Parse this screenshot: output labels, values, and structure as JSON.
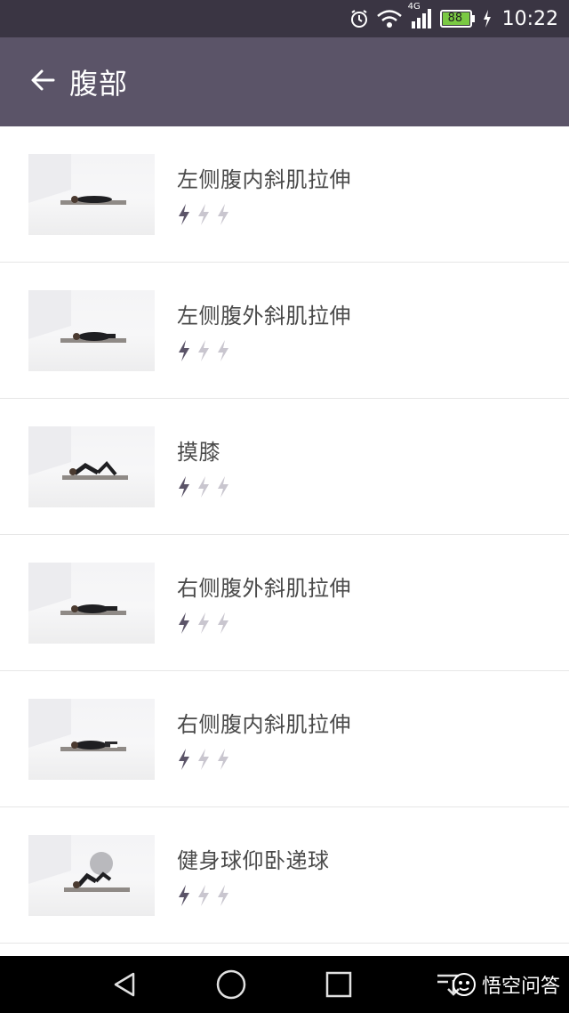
{
  "status_bar": {
    "time": "10:22",
    "network": "4G",
    "battery": "88",
    "icons": [
      "alarm-icon",
      "wifi-icon",
      "signal-icon",
      "battery-icon",
      "charging-icon"
    ]
  },
  "app_bar": {
    "title": "腹部",
    "back_icon": "arrow-left-icon"
  },
  "exercises": [
    {
      "title": "左侧腹内斜肌拉伸",
      "difficulty": 1,
      "difficulty_max": 3
    },
    {
      "title": "左侧腹外斜肌拉伸",
      "difficulty": 1,
      "difficulty_max": 3
    },
    {
      "title": "摸膝",
      "difficulty": 1,
      "difficulty_max": 3
    },
    {
      "title": "右侧腹外斜肌拉伸",
      "difficulty": 1,
      "difficulty_max": 3
    },
    {
      "title": "右侧腹内斜肌拉伸",
      "difficulty": 1,
      "difficulty_max": 3
    },
    {
      "title": "健身球仰卧递球",
      "difficulty": 1,
      "difficulty_max": 3
    }
  ],
  "nav_bar": {
    "buttons": [
      "back-triangle-icon",
      "home-circle-icon",
      "recents-square-icon",
      "notification-drawer-icon"
    ]
  },
  "watermark": {
    "text": "悟空问答"
  },
  "colors": {
    "status_bar": "#3a3543",
    "app_bar": "#5b5468",
    "bolt_active": "#5b5468",
    "bolt_inactive": "#c9c6cf"
  }
}
